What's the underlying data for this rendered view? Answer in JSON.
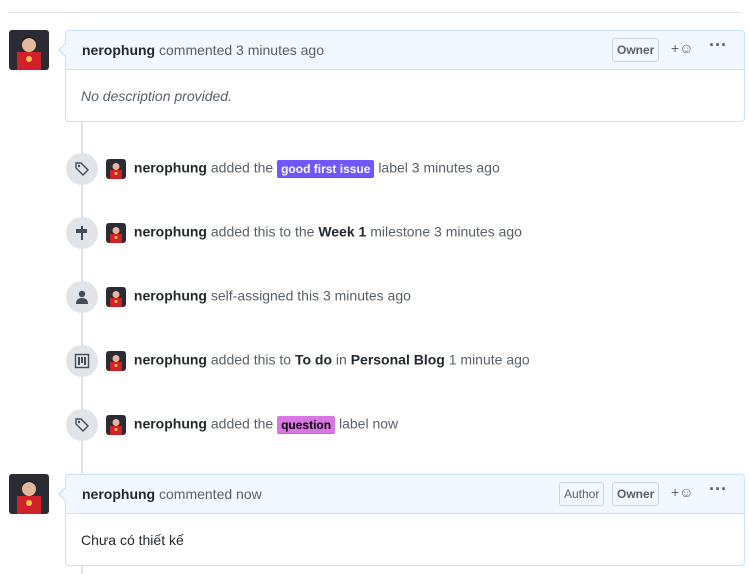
{
  "comment1": {
    "author": "nerophung",
    "action": "commented",
    "time": "3 minutes ago",
    "role_badges": [
      "Owner"
    ],
    "reaction_label": "+☺",
    "body": "No description provided."
  },
  "events": [
    {
      "icon": "tag-icon",
      "author": "nerophung",
      "pre": "added the",
      "label": {
        "text": "good first issue",
        "bg": "#7057ff",
        "fg": "#ffffff"
      },
      "post": "label",
      "time": "3 minutes ago"
    },
    {
      "icon": "milestone-icon",
      "author": "nerophung",
      "pre": "added this to the",
      "bold": "Week 1",
      "post": "milestone",
      "time": "3 minutes ago"
    },
    {
      "icon": "person-icon",
      "author": "nerophung",
      "pre": "self-assigned this",
      "time": "3 minutes ago"
    },
    {
      "icon": "project-icon",
      "author": "nerophung",
      "pre": "added this to",
      "bold": "To do",
      "mid": "in",
      "bold2": "Personal Blog",
      "time": "1 minute ago"
    },
    {
      "icon": "tag-icon",
      "author": "nerophung",
      "pre": "added the",
      "label": {
        "text": "question",
        "bg": "#d876e3",
        "fg": "#000000"
      },
      "post": "label",
      "time": "now"
    }
  ],
  "comment2": {
    "author": "nerophung",
    "action": "commented",
    "time": "now",
    "role_badges": [
      "Author",
      "Owner"
    ],
    "reaction_label": "+☺",
    "body": "Chưa có thiết kế"
  },
  "colors": {
    "border": "#c8e1ff",
    "header_bg": "#f1f8ff",
    "avatar_red": "#d0202a"
  }
}
